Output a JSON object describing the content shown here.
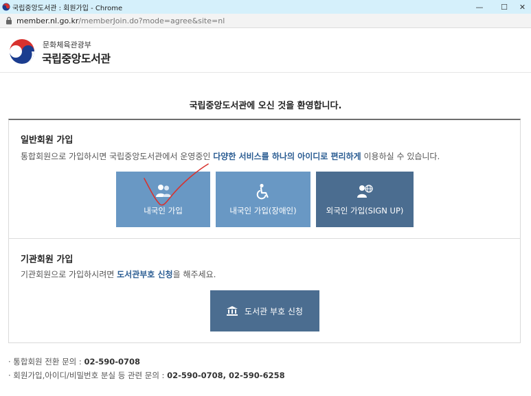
{
  "browser": {
    "window_title": "국립중앙도서관 : 회원가입 - Chrome",
    "url_host": "member.nl.go.kr",
    "url_path": "/memberJoin.do?mode=agree&site=nl",
    "controls": {
      "minimize": "—",
      "maximize": "☐",
      "close": "✕"
    }
  },
  "header": {
    "ministry": "문화체육관광부",
    "library_name": "국립중앙도서관"
  },
  "welcome": "국립중앙도서관에 오신 것을 환영합니다.",
  "general": {
    "title": "일반회원 가입",
    "desc_before": "통합회원으로 가입하시면 국립중앙도서관에서 운영중인 ",
    "desc_highlight": "다양한 서비스를 하나의 아이디로 편리하게",
    "desc_after": " 이용하실 수 있습니다.",
    "buttons": [
      {
        "label": "내국인 가입",
        "icon": "users-icon"
      },
      {
        "label": "내국인 가입(장애인)",
        "icon": "wheelchair-icon"
      },
      {
        "label": "외국인 가입(SIGN UP)",
        "icon": "globe-user-icon"
      }
    ]
  },
  "institution": {
    "title": "기관회원 가입",
    "desc_before": "기관회원으로 가입하시려면 ",
    "desc_highlight": "도서관부호 신청",
    "desc_after": "을 해주세요.",
    "button": {
      "label": "도서관 부호 신청",
      "icon": "institution-icon"
    }
  },
  "footer": [
    {
      "label": "· 통합회원 전환 문의 : ",
      "number": "02-590-0708"
    },
    {
      "label": "· 회원가입,아이디/비밀번호 분실 등 관련 문의 : ",
      "number": "02-590-0708, 02-590-6258"
    }
  ],
  "colors": {
    "button_light": "#6998c4",
    "button_dark": "#4b6d90",
    "highlight_text": "#2a5c92",
    "annotation_mark": "#d8322e"
  }
}
